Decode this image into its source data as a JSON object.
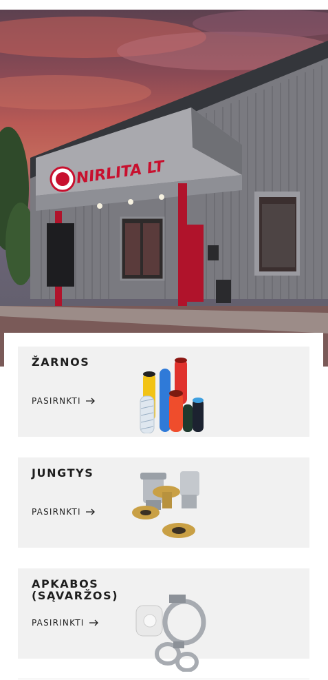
{
  "hero": {
    "image": "storefront-photo",
    "sign_text": "NIRLITA LT"
  },
  "categories": [
    {
      "title": "ŽARNOS",
      "link_label": "PASIRNKTI",
      "icon": "hoses-image"
    },
    {
      "title": "JUNGTYS",
      "link_label": "PASIRNKTI",
      "icon": "couplings-image"
    },
    {
      "title": "APKABOS\n(SĄVARŽOS)",
      "link_label": "PASIRINKTI",
      "icon": "clamps-image"
    }
  ],
  "colors": {
    "card_bg": "#f1f1f1",
    "text": "#1e1e1e",
    "brand_red": "#c8102e"
  }
}
